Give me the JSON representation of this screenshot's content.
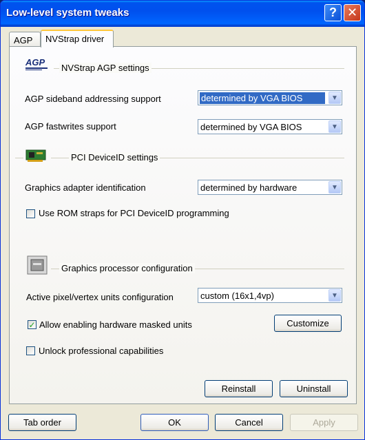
{
  "window": {
    "title": "Low-level system tweaks"
  },
  "tabs": [
    {
      "label": "AGP"
    },
    {
      "label": "NVStrap driver"
    }
  ],
  "agp_group": {
    "title": "NVStrap AGP settings",
    "logo_text": "AGP",
    "sideband": {
      "label": "AGP sideband addressing support",
      "value": "determined by VGA BIOS"
    },
    "fastwrites": {
      "label": "AGP fastwrites support",
      "value": "determined by VGA BIOS"
    }
  },
  "pci_group": {
    "title": "PCI DeviceID settings",
    "identification": {
      "label": "Graphics adapter identification",
      "value": "determined by hardware"
    },
    "rom_straps": {
      "label": "Use ROM straps for PCI DeviceID programming",
      "checked": false
    }
  },
  "gpu_group": {
    "title": "Graphics processor configuration",
    "units": {
      "label": "Active pixel/vertex units configuration",
      "value": "custom (16x1,4vp)"
    },
    "masked_units": {
      "label": "Allow enabling hardware masked units",
      "checked": true
    },
    "customize_label": "Customize",
    "professional": {
      "label": "Unlock professional capabilities",
      "checked": false
    }
  },
  "panel_buttons": {
    "reinstall": "Reinstall",
    "uninstall": "Uninstall"
  },
  "footer": {
    "tab_order": "Tab order",
    "ok": "OK",
    "cancel": "Cancel",
    "apply": "Apply"
  }
}
